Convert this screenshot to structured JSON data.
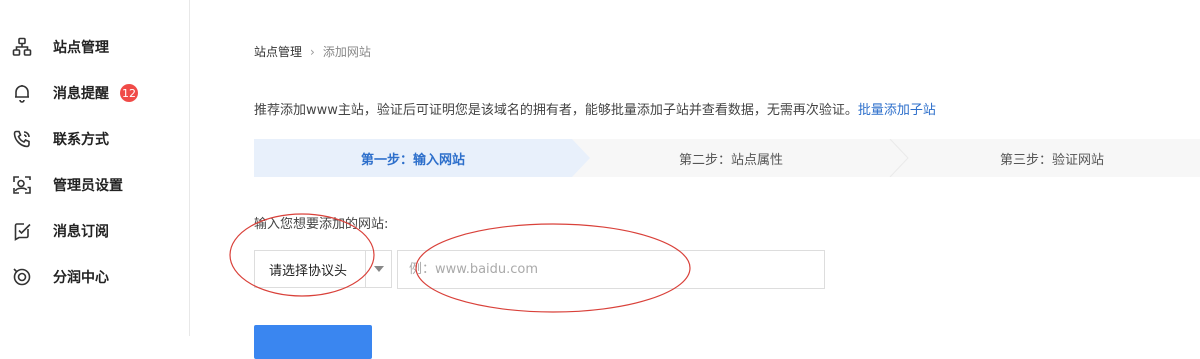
{
  "sidebar": {
    "items": [
      {
        "label": "站点管理",
        "icon": "sitemap-icon"
      },
      {
        "label": "消息提醒",
        "icon": "bell-icon",
        "badge": "12"
      },
      {
        "label": "联系方式",
        "icon": "phone-icon"
      },
      {
        "label": "管理员设置",
        "icon": "admin-icon"
      },
      {
        "label": "消息订阅",
        "icon": "subscribe-icon"
      },
      {
        "label": "分润中心",
        "icon": "revenue-icon"
      }
    ]
  },
  "breadcrumb": {
    "root": "站点管理",
    "separator": "›",
    "current": "添加网站"
  },
  "intro": {
    "text": "推荐添加www主站，验证后可证明您是该域名的拥有者，能够批量添加子站并查看数据，无需再次验证。",
    "link": "批量添加子站"
  },
  "steps": [
    {
      "label": "第一步：输入网站",
      "active": true
    },
    {
      "label": "第二步：站点属性",
      "active": false
    },
    {
      "label": "第三步：验证网站",
      "active": false
    }
  ],
  "form": {
    "label": "输入您想要添加的网站:",
    "protocol": "请选择协议头",
    "url_placeholder": "例：www.baidu.com"
  },
  "colors": {
    "accent": "#2d6fcb",
    "badge": "#f04b48",
    "annotation": "#d9413a",
    "step_active_bg": "#e8f0fb"
  }
}
